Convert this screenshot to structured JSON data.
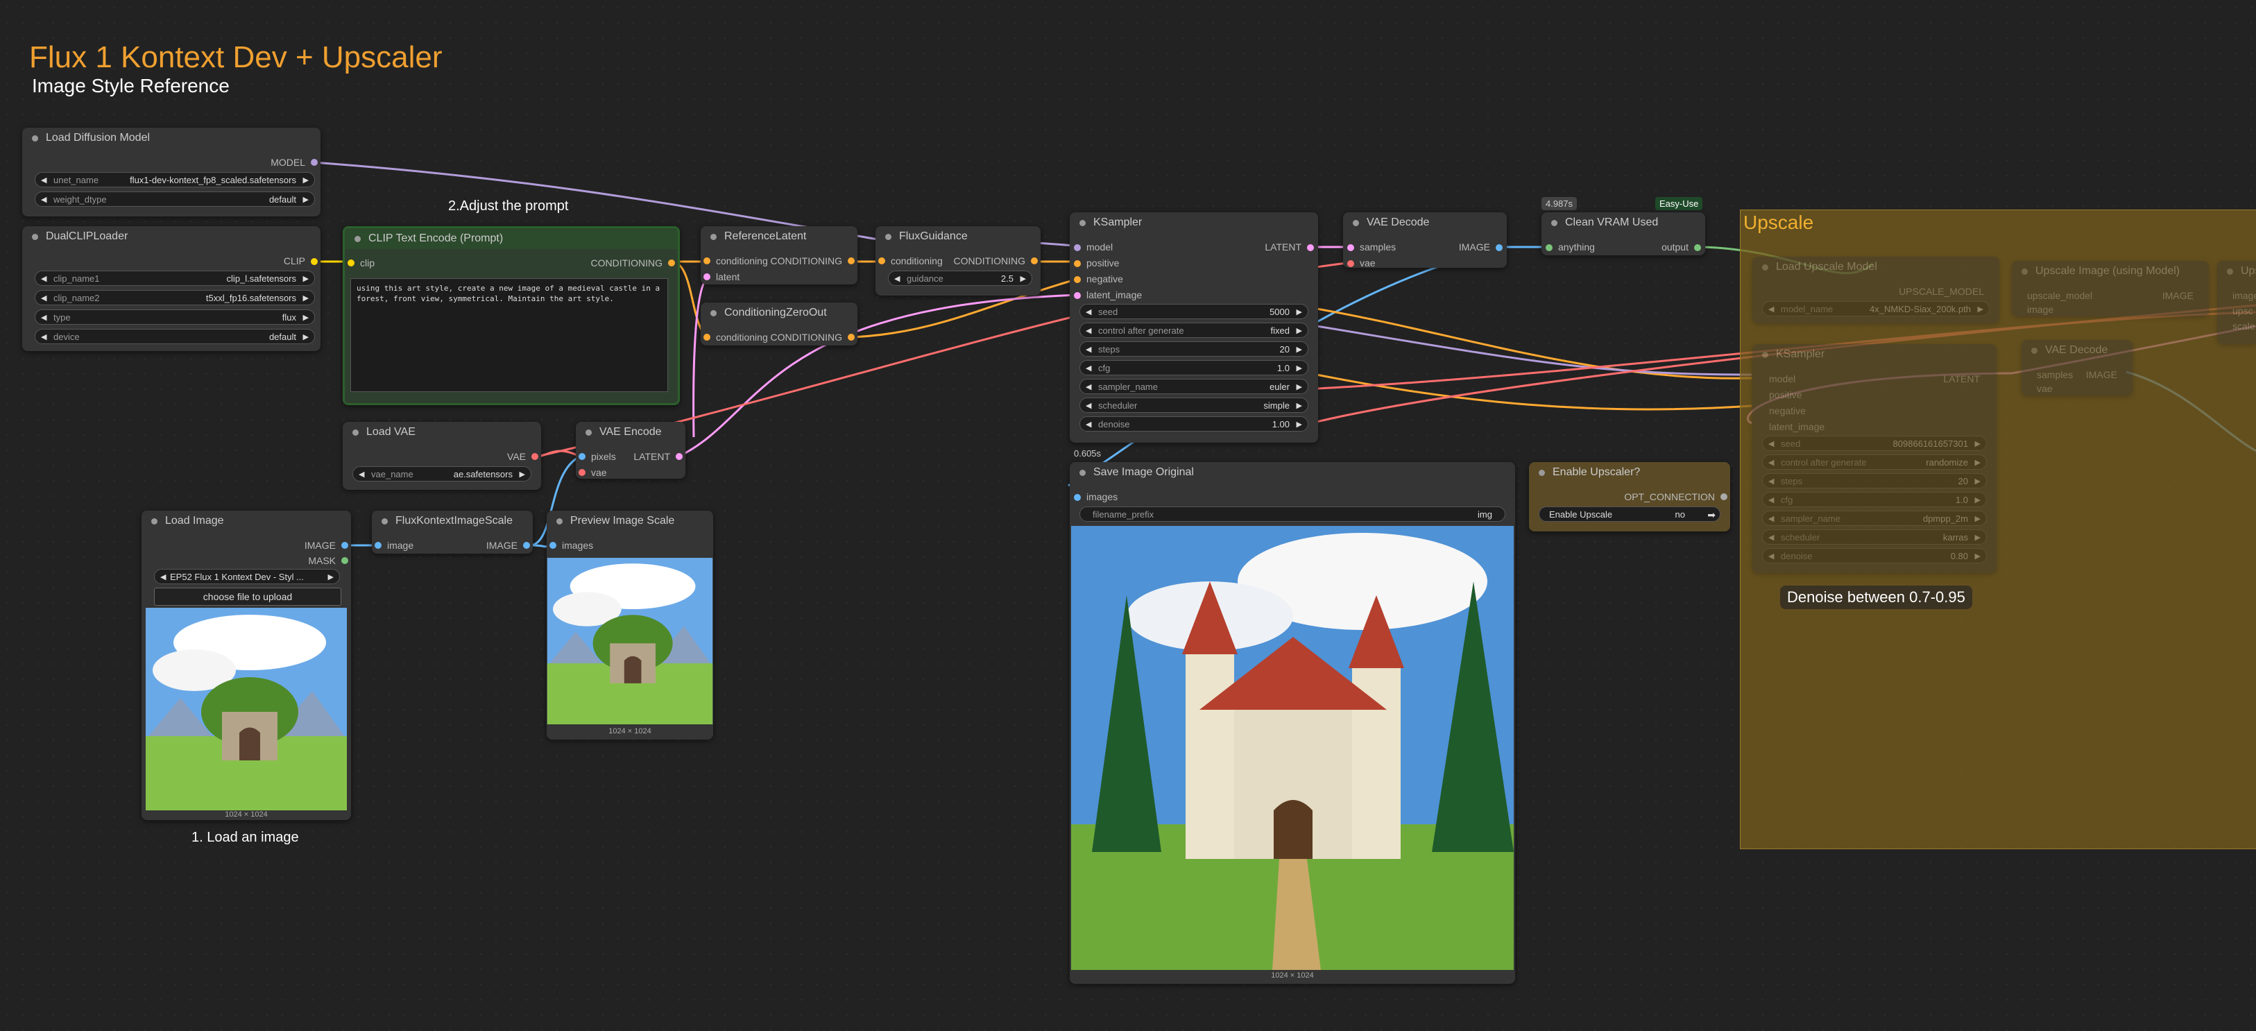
{
  "page": {
    "title": "Flux 1 Kontext Dev + Upscaler",
    "subtitle": "Image Style Reference"
  },
  "notes": {
    "adjust_prompt": "2.Adjust the prompt",
    "load_image": "1. Load an image",
    "denoise": "Denoise between 0.7-0.95"
  },
  "badges": {
    "vram_time": "4.987s",
    "easy_use": "Easy-Use",
    "save_time": "0.605s"
  },
  "group": {
    "upscale": "Upscale"
  },
  "nodes": {
    "load_diffusion": {
      "title": "Load Diffusion Model",
      "out": "MODEL",
      "unet_label": "unet_name",
      "unet_value": "flux1-dev-kontext_fp8_scaled.safetensors",
      "dtype_label": "weight_dtype",
      "dtype_value": "default"
    },
    "dualclip": {
      "title": "DualCLIPLoader",
      "out": "CLIP",
      "w1l": "clip_name1",
      "w1v": "clip_l.safetensors",
      "w2l": "clip_name2",
      "w2v": "t5xxl_fp16.safetensors",
      "w3l": "type",
      "w3v": "flux",
      "w4l": "device",
      "w4v": "default"
    },
    "clip_text": {
      "title": "CLIP Text Encode (Prompt)",
      "in": "clip",
      "out": "CONDITIONING",
      "prompt": "using this art style, create a new image of a medieval castle in a forest, front view, symmetrical. Maintain the art style."
    },
    "ref_latent": {
      "title": "ReferenceLatent",
      "in1": "conditioning",
      "in2": "latent",
      "out": "CONDITIONING"
    },
    "cond_zero": {
      "title": "ConditioningZeroOut",
      "in": "conditioning",
      "out": "CONDITIONING"
    },
    "flux_guidance": {
      "title": "FluxGuidance",
      "in": "conditioning",
      "out": "CONDITIONING",
      "wl": "guidance",
      "wv": "2.5"
    },
    "ksampler": {
      "title": "KSampler",
      "in1": "model",
      "in2": "positive",
      "in3": "negative",
      "in4": "latent_image",
      "out": "LATENT",
      "widgets": [
        {
          "l": "seed",
          "v": "5000"
        },
        {
          "l": "control after generate",
          "v": "fixed"
        },
        {
          "l": "steps",
          "v": "20"
        },
        {
          "l": "cfg",
          "v": "1.0"
        },
        {
          "l": "sampler_name",
          "v": "euler"
        },
        {
          "l": "scheduler",
          "v": "simple"
        },
        {
          "l": "denoise",
          "v": "1.00"
        }
      ]
    },
    "vae_decode": {
      "title": "VAE Decode",
      "in1": "samples",
      "in2": "vae",
      "out": "IMAGE"
    },
    "clean_vram": {
      "title": "Clean VRAM Used",
      "in": "anything",
      "out": "output"
    },
    "load_vae": {
      "title": "Load VAE",
      "out": "VAE",
      "wl": "vae_name",
      "wv": "ae.safetensors"
    },
    "vae_encode": {
      "title": "VAE Encode",
      "in1": "pixels",
      "in2": "vae",
      "out": "LATENT"
    },
    "load_image": {
      "title": "Load Image",
      "out1": "IMAGE",
      "out2": "MASK",
      "wv": "EP52 Flux 1 Kontext Dev - Styl ...",
      "upload": "choose file to upload",
      "size": "1024 × 1024"
    },
    "kontext_scale": {
      "title": "FluxKontextImageScale",
      "in": "image",
      "out": "IMAGE"
    },
    "preview": {
      "title": "Preview Image Scale",
      "in": "images",
      "size": "1024 × 1024"
    },
    "save": {
      "title": "Save Image Original",
      "in": "images",
      "wl": "filename_prefix",
      "wv": "img",
      "size": "1024 × 1024"
    },
    "enable_up": {
      "title": "Enable Upscaler?",
      "out": "OPT_CONNECTION",
      "wl": "Enable Upscale",
      "wv": "no"
    },
    "load_up": {
      "title": "Load Upscale Model",
      "out": "UPSCALE_MODEL",
      "wl": "model_name",
      "wv": "4x_NMKD-Siax_200k.pth"
    },
    "up_image": {
      "title": "Upscale Image (using Model)",
      "in1": "upscale_model",
      "in2": "image",
      "out": "IMAGE"
    },
    "up_more": {
      "title": "Upsc",
      "in1": "image",
      "in2": "upsc",
      "in3": "scale"
    },
    "ks2": {
      "title": "KSampler",
      "in1": "model",
      "in2": "positive",
      "in3": "negative",
      "in4": "latent_image",
      "out": "LATENT",
      "widgets": [
        {
          "l": "seed",
          "v": "809866161657301"
        },
        {
          "l": "control after generate",
          "v": "randomize"
        },
        {
          "l": "steps",
          "v": "20"
        },
        {
          "l": "cfg",
          "v": "1.0"
        },
        {
          "l": "sampler_name",
          "v": "dpmpp_2m"
        },
        {
          "l": "scheduler",
          "v": "karras"
        },
        {
          "l": "denoise",
          "v": "0.80"
        }
      ]
    },
    "vae_decode2": {
      "title": "VAE Decode",
      "in1": "samples",
      "in2": "vae",
      "out": "IMAGE"
    }
  },
  "colors": {
    "model": "#b39ddb",
    "clip": "#ffd500",
    "conditioning": "#ffa931",
    "latent": "#ff9cf9",
    "vae": "#ff6e6e",
    "image": "#64b5f6",
    "any": "#7ac47a",
    "group": "#7a5f1e"
  }
}
